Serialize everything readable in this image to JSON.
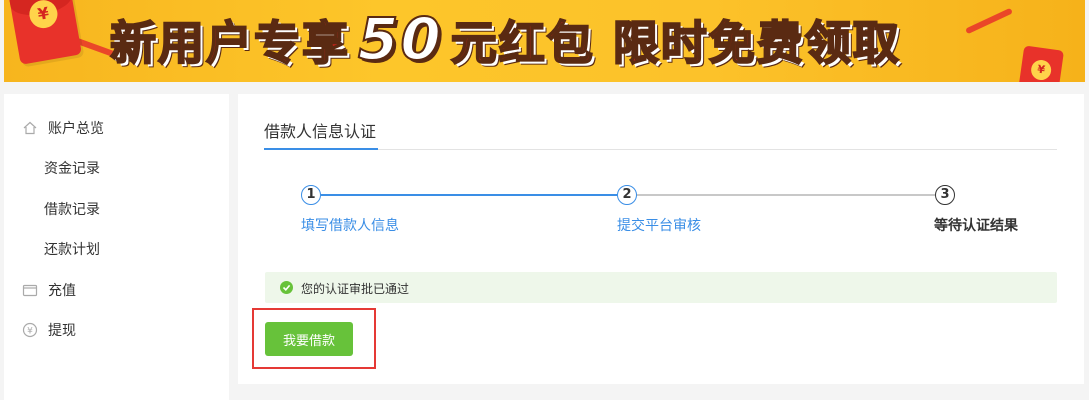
{
  "banner": {
    "slogan_part1": "新用户专享",
    "slogan_number": "50",
    "slogan_part2": "元红包 限时免费领取",
    "coin_symbol": "¥"
  },
  "sidebar": {
    "items": [
      {
        "label": "账户总览",
        "icon": "home-icon"
      },
      {
        "label": "资金记录"
      },
      {
        "label": "借款记录"
      },
      {
        "label": "还款计划"
      },
      {
        "label": "充值",
        "icon": "wallet-icon"
      },
      {
        "label": "提现",
        "icon": "yuan-icon",
        "icon_glyph": "¥"
      }
    ]
  },
  "main": {
    "title": "借款人信息认证",
    "steps": [
      {
        "number": "1",
        "label": "填写借款人信息",
        "status": "done"
      },
      {
        "number": "2",
        "label": "提交平台审核",
        "status": "done"
      },
      {
        "number": "3",
        "label": "等待认证结果",
        "status": "current"
      }
    ],
    "alert": {
      "message": "您的认证审批已通过",
      "icon": "check-circle-icon"
    },
    "button_label": "我要借款"
  },
  "colors": {
    "accent_blue": "#3a8ee6",
    "success_green": "#67c23a",
    "alert_bg": "#eef7ea",
    "highlight_red": "#e53935",
    "banner_yellow": "#fdc62a"
  }
}
